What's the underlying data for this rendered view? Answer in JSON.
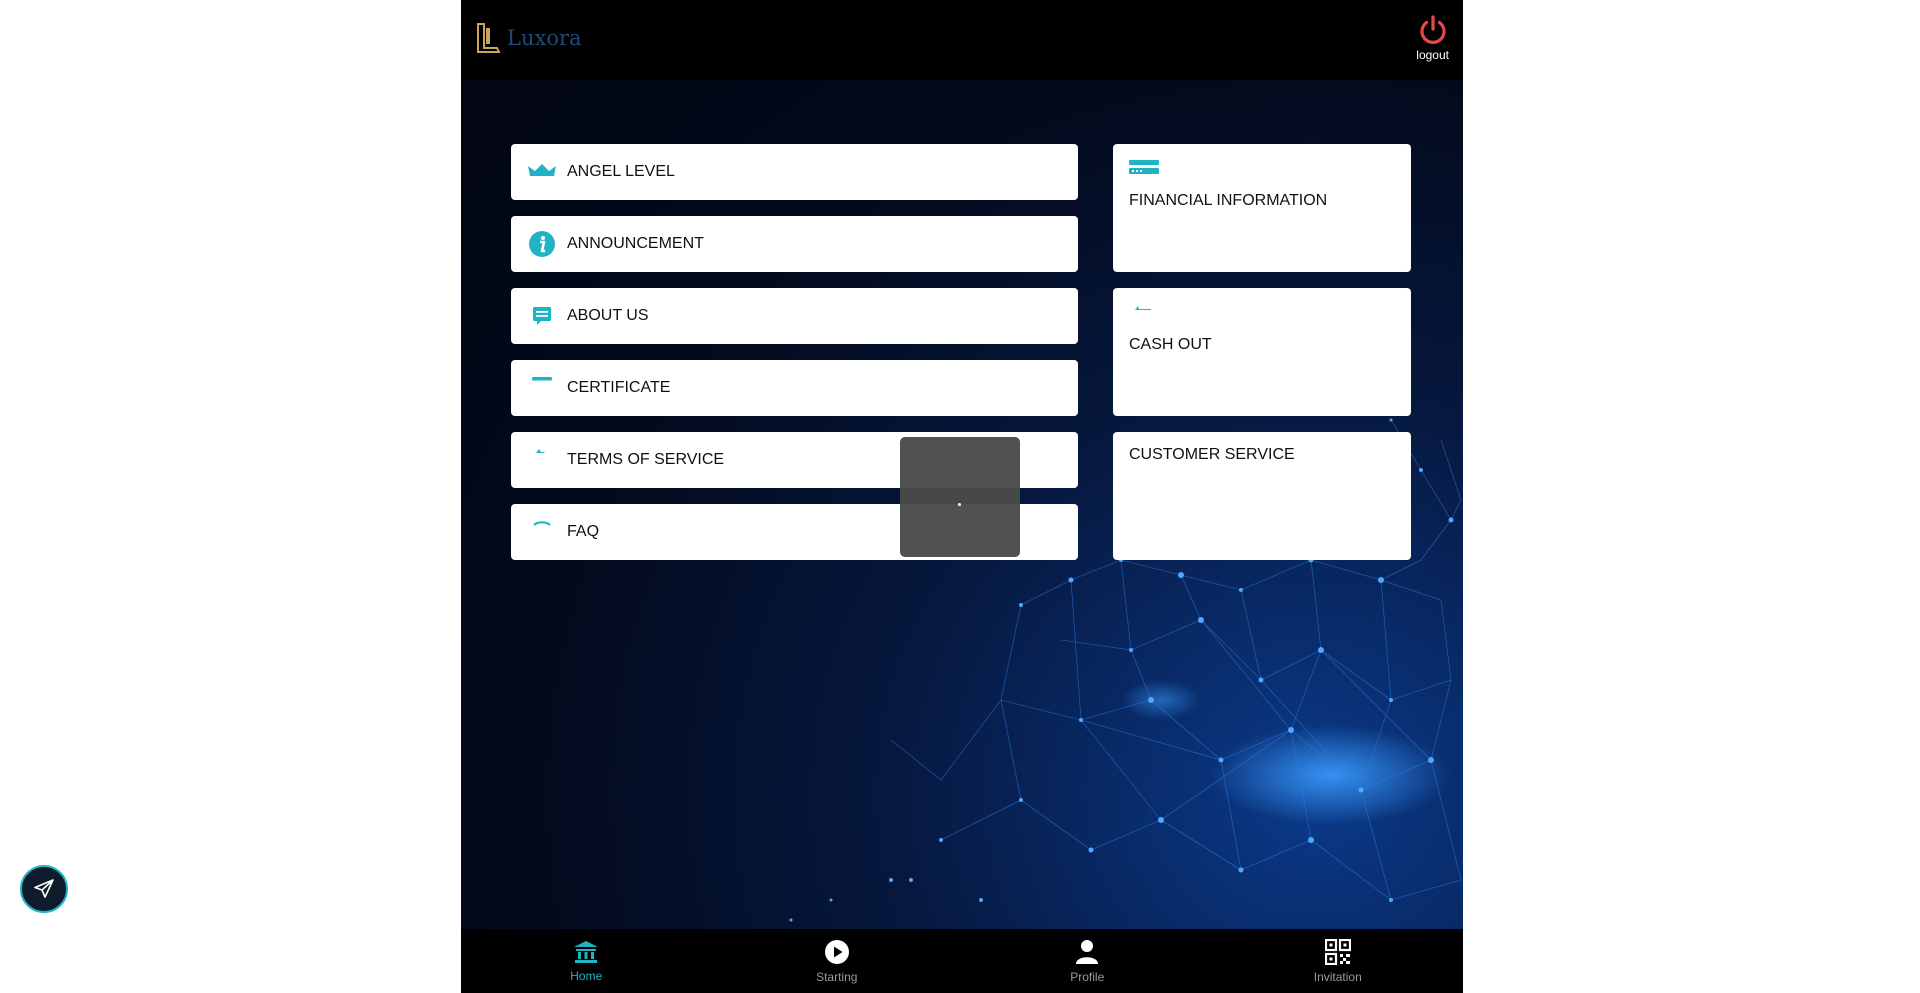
{
  "header": {
    "brand": "Luxora",
    "logout_label": "logout"
  },
  "menu": [
    {
      "label": "ANGEL LEVEL",
      "icon": "crown-icon"
    },
    {
      "label": "ANNOUNCEMENT",
      "icon": "info-icon"
    },
    {
      "label": "ABOUT US",
      "icon": "message-icon"
    },
    {
      "label": "CERTIFICATE",
      "icon": "certificate-icon"
    },
    {
      "label": "TERMS OF SERVICE",
      "icon": "document-icon"
    },
    {
      "label": "FAQ",
      "icon": "question-icon"
    }
  ],
  "cards": [
    {
      "label": "FINANCIAL INFORMATION",
      "icon": "credit-card-icon"
    },
    {
      "label": "CASH OUT",
      "icon": "withdraw-icon"
    },
    {
      "label": "CUSTOMER SERVICE",
      "icon": "support-icon"
    }
  ],
  "bottom_nav": [
    {
      "label": "Home",
      "icon": "bank-icon",
      "active": true
    },
    {
      "label": "Starting",
      "icon": "play-icon",
      "active": false
    },
    {
      "label": "Profile",
      "icon": "user-icon",
      "active": false
    },
    {
      "label": "Invitation",
      "icon": "qr-code-icon",
      "active": false
    }
  ],
  "colors": {
    "accent": "#1fb3c4",
    "logout_red": "#e8474c",
    "header_bg": "#000000",
    "card_bg": "#ffffff"
  }
}
